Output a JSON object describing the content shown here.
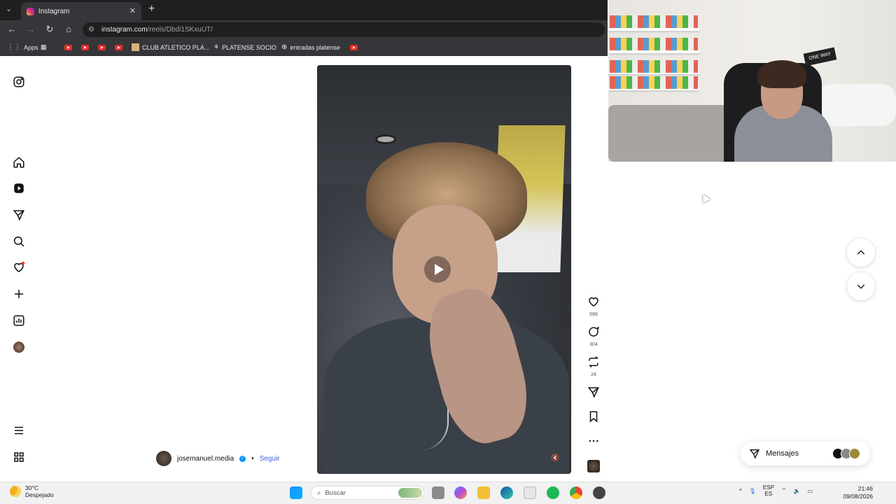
{
  "browser": {
    "tab_title": "Instagram",
    "url_host": "instagram.com",
    "url_path": "/reels/Dbdi1SKxuUT/",
    "bookmarks": [
      "Apps",
      "CLUB ATLETICO PLA...",
      "PLATENSE SOCIO",
      "entradas platense"
    ]
  },
  "reel": {
    "username": "josemanuel.media",
    "follow_label": "Seguir",
    "separator": "•",
    "likes": "596",
    "comments": "304",
    "reposts": "24"
  },
  "messages": {
    "label": "Mensajes"
  },
  "taskbar": {
    "temperature": "30°C",
    "weather_text": "Despejado",
    "search_placeholder": "Buscar",
    "lang_top": "ESP",
    "lang_bottom": "ES",
    "time": "21:46",
    "date": "09/08/2026"
  },
  "colors": {
    "accent_blue": "#0095f6",
    "follow_link": "#3b5bdb",
    "notification_dot": "#ff3040"
  },
  "icons": {
    "sidebar": [
      "instagram-logo-icon",
      "home-icon",
      "reels-icon",
      "send-icon",
      "search-icon",
      "heart-icon",
      "plus-icon",
      "dashboard-icon",
      "profile-avatar",
      "menu-icon",
      "apps-grid-icon"
    ],
    "actions": [
      "heart-icon",
      "comment-icon",
      "repost-icon",
      "send-icon",
      "bookmark-icon",
      "more-icon",
      "audio-thumbnail"
    ]
  }
}
